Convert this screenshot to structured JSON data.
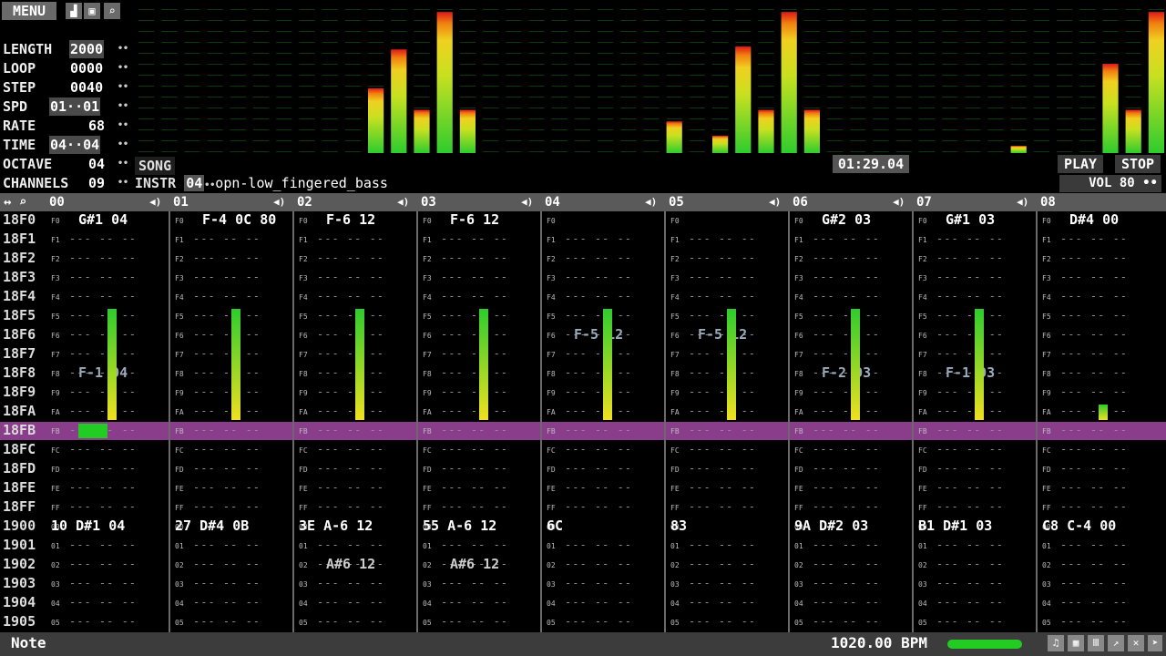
{
  "menu": {
    "label": "MENU"
  },
  "params": [
    {
      "label": "LENGTH",
      "value": "2000"
    },
    {
      "label": "LOOP",
      "value": "0000"
    },
    {
      "label": "STEP",
      "value": "0040"
    },
    {
      "label": "SPD",
      "value": "01··01"
    },
    {
      "label": "RATE",
      "value": "68"
    },
    {
      "label": "TIME",
      "value": "04··04"
    },
    {
      "label": "OCTAVE",
      "value": "04"
    },
    {
      "label": "CHANNELS",
      "value": "09"
    }
  ],
  "song_label": "SONG",
  "instr": {
    "label": "INSTR",
    "number": "04",
    "name": "opn-low_fingered_bass"
  },
  "time_readout": "01:29.04",
  "play_label": "PLAY",
  "stop_label": "STOP",
  "vol_label": "VOL 80",
  "channels": [
    "00",
    "01",
    "02",
    "03",
    "04",
    "05",
    "06",
    "07",
    "08"
  ],
  "rows": [
    "18F0",
    "18F1",
    "18F2",
    "18F3",
    "18F4",
    "18F5",
    "18F6",
    "18F7",
    "18F8",
    "18F9",
    "18FA",
    "18FB",
    "18FC",
    "18FD",
    "18FE",
    "18FF",
    "1900",
    "1901",
    "1902",
    "1903",
    "1904",
    "1905"
  ],
  "cursor_row_index": 11,
  "sub_labels": [
    "F0",
    "F1",
    "F2",
    "F3",
    "F4",
    "F5",
    "F6",
    "F7",
    "F8",
    "F9",
    "FA",
    "FB",
    "FC",
    "FD",
    "FE",
    "FF",
    "00",
    "01",
    "02",
    "03",
    "04",
    "05"
  ],
  "top_cells": [
    {
      "text": "G#1 04"
    },
    {
      "text": "F-4 0C 80"
    },
    {
      "text": "F-6 12"
    },
    {
      "text": "F-6 12"
    },
    {
      "text": ""
    },
    {
      "text": ""
    },
    {
      "text": "G#2 03"
    },
    {
      "text": "G#1 03"
    },
    {
      "text": "D#4 00"
    }
  ],
  "mid_cells": [
    {
      "ch": 0,
      "row": 8,
      "text": "F-1 04"
    },
    {
      "ch": 4,
      "row": 6,
      "text": "F-5 12"
    },
    {
      "ch": 5,
      "row": 6,
      "text": "F-5 12"
    },
    {
      "ch": 6,
      "row": 8,
      "text": "F-2 03"
    },
    {
      "ch": 7,
      "row": 8,
      "text": "F-1 03"
    }
  ],
  "row1900_cells": [
    {
      "text": "10 D#1 04"
    },
    {
      "text": "27 D#4 0B"
    },
    {
      "text": "3E A-6 12"
    },
    {
      "text": "55 A-6 12"
    },
    {
      "text": "6C"
    },
    {
      "text": "83"
    },
    {
      "text": "9A D#2 03"
    },
    {
      "text": "B1 D#1 03"
    },
    {
      "text": "C8 C-4 00"
    }
  ],
  "row1902_cells": [
    {
      "ch": 2,
      "text": "A#6 12"
    },
    {
      "ch": 3,
      "text": "A#6 12"
    }
  ],
  "status": {
    "mode_label": "Note",
    "bpm": "1020.00 BPM"
  },
  "colors": {
    "accent_purple": "#8a3d8a",
    "bar_green": "#2ecc2e",
    "bar_yellow": "#f0e020",
    "bar_red": "#e01818",
    "panel_gray": "#5a5a5a"
  },
  "viz_levels": [
    0,
    0,
    0,
    0,
    0,
    0,
    0,
    0,
    0,
    0,
    0.45,
    0.72,
    0.3,
    0.98,
    0.3,
    0,
    0,
    0,
    0,
    0,
    0,
    0,
    0,
    0.22,
    0,
    0.12,
    0.74,
    0.3,
    0.98,
    0.3,
    0,
    0,
    0,
    0,
    0,
    0,
    0,
    0,
    0.05,
    0,
    0,
    0,
    0.62,
    0.3,
    0.98
  ],
  "icons": [
    "chart-icon",
    "save-icon",
    "search-icon",
    "speaker-icon",
    "note-icon",
    "grid-icon",
    "bars-icon",
    "chart-small-icon",
    "wrench-icon",
    "arrow-icon"
  ]
}
